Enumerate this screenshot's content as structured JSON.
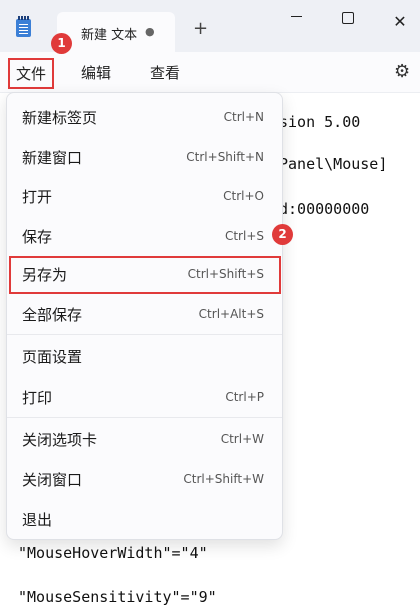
{
  "titlebar": {
    "tab_title": "新建 文本",
    "tab_unsaved_dot": "●",
    "new_tab": "+",
    "minimize_icon": "minimize-icon",
    "maximize_icon": "maximize-icon",
    "close_symbol": "✕"
  },
  "menubar": {
    "file": "文件",
    "edit": "编辑",
    "view": "查看",
    "settings_icon": "gear-icon",
    "settings_glyph": "⚙"
  },
  "badges": {
    "b1": "1",
    "b2": "2"
  },
  "editor": {
    "lines_right": [
      "sion 5.00",
      "Panel\\Mouse]",
      "d:00000000"
    ],
    "lines_bottom": [
      "\"MouseHoverWidth\"=\"4\"",
      "\"MouseSensitivity\"=\"9\""
    ]
  },
  "file_menu": {
    "items": [
      {
        "label": "新建标签页",
        "shortcut": "Ctrl+N"
      },
      {
        "label": "新建窗口",
        "shortcut": "Ctrl+Shift+N"
      },
      {
        "label": "打开",
        "shortcut": "Ctrl+O"
      },
      {
        "label": "保存",
        "shortcut": "Ctrl+S"
      },
      {
        "label": "另存为",
        "shortcut": "Ctrl+Shift+S"
      },
      {
        "label": "全部保存",
        "shortcut": "Ctrl+Alt+S"
      },
      {
        "label": "页面设置",
        "shortcut": ""
      },
      {
        "label": "打印",
        "shortcut": "Ctrl+P"
      },
      {
        "label": "关闭选项卡",
        "shortcut": "Ctrl+W"
      },
      {
        "label": "关闭窗口",
        "shortcut": "Ctrl+Shift+W"
      },
      {
        "label": "退出",
        "shortcut": ""
      }
    ]
  },
  "colors": {
    "highlight": "#e03a3a",
    "titlebar_bg": "#eef0f5"
  }
}
